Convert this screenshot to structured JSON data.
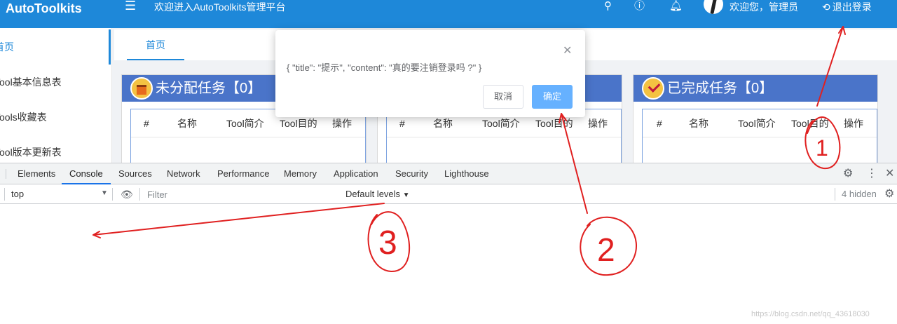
{
  "header": {
    "logo": "AutoToolkits",
    "welcome_title": "欢迎进入AutoToolkits管理平台",
    "welcome_user": "欢迎您，管理员",
    "logout": "退出登录"
  },
  "sidebar": {
    "items": [
      {
        "label": "首页"
      },
      {
        "label": "Tool基本信息表"
      },
      {
        "label": "Tools收藏表"
      },
      {
        "label": "Tool版本更新表"
      }
    ]
  },
  "tabs": {
    "home": "首页"
  },
  "panels": [
    {
      "title": "未分配任务【0】"
    },
    {
      "title": ""
    },
    {
      "title": "已完成任务【0】"
    }
  ],
  "table": {
    "columns": [
      "#",
      "名称",
      "Tool简介",
      "Tool目的",
      "操作"
    ]
  },
  "modal": {
    "content": "{ \"title\": \"提示\", \"content\": \"真的要注销登录吗 ?\" }",
    "cancel": "取消",
    "confirm": "确定"
  },
  "devtools": {
    "tabs": [
      "Elements",
      "Console",
      "Sources",
      "Network",
      "Performance",
      "Memory",
      "Application",
      "Security",
      "Lighthouse"
    ],
    "active_tab": "Console",
    "context": "top",
    "filter_placeholder": "Filter",
    "levels": "Default levels",
    "hidden": "4 hidden"
  },
  "annotations": {
    "mark_1": "1",
    "mark_2": "2",
    "mark_3": "3",
    "color": "#e02020"
  },
  "watermark": "https://blog.csdn.net/qq_43618030"
}
